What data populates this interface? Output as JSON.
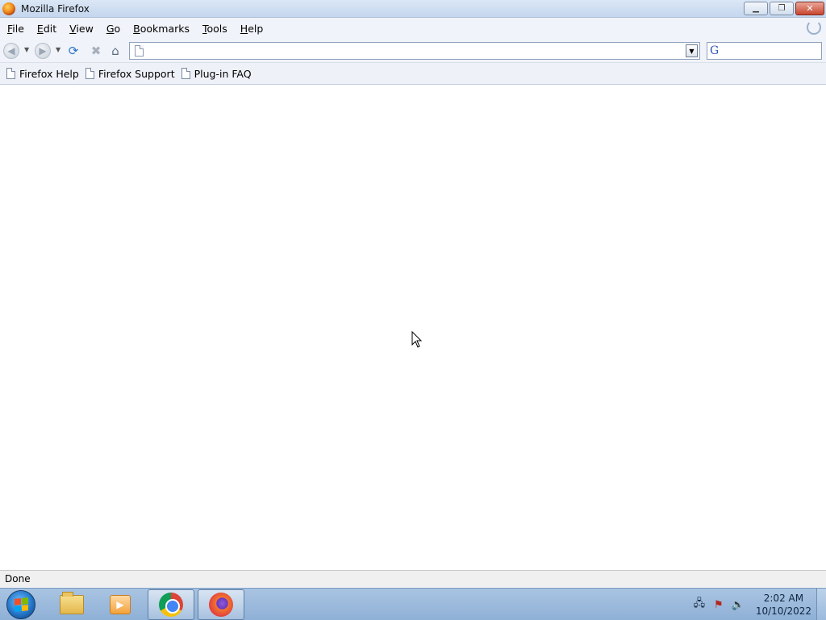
{
  "window": {
    "title": "Mozilla Firefox",
    "controls": {
      "minimize": "▁",
      "restore": "❐",
      "close": "✕"
    }
  },
  "menubar": {
    "items": [
      "File",
      "Edit",
      "View",
      "Go",
      "Bookmarks",
      "Tools",
      "Help"
    ]
  },
  "navbar": {
    "url_value": "",
    "search_value": "",
    "search_engine_glyph": "G"
  },
  "bookmarks": {
    "items": [
      "Firefox Help",
      "Firefox Support",
      "Plug-in FAQ"
    ]
  },
  "statusbar": {
    "text": "Done"
  },
  "taskbar": {
    "time": "2:02 AM",
    "date": "10/10/2022"
  }
}
